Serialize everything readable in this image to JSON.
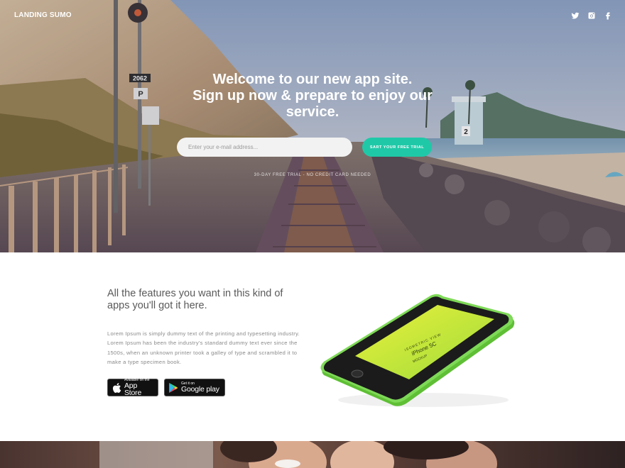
{
  "header": {
    "brand": "LANDING SUMO",
    "social_icons": [
      "twitter-icon",
      "instagram-icon",
      "facebook-icon"
    ]
  },
  "hero": {
    "headline_lines": [
      "Welcome to our new app site.",
      "Sign up now & prepare to enjoy our",
      "service."
    ],
    "email_placeholder": "Enter your e-mail address...",
    "cta_label": "SART YOUR FREE TRIAL",
    "note": "30-DAY FREE TRIAL - NO CREDIT CARD NEEDED"
  },
  "features": {
    "title_lines": [
      "All the features you want in this kind of",
      "apps you'll got it here."
    ],
    "body": "Lorem Ipsum is simply dummy text of the printing and typesetting industry. Lorem Ipsum has been the industry's standard dummy text ever since the 1500s, when an unknown printer took a galley of type and scrambled it to make a type specimen book.",
    "app_store": {
      "small": "Available on the",
      "big": "App Store"
    },
    "google_play": {
      "small": "Get it on",
      "big": "Google play"
    },
    "phone_screen": {
      "line1": "ISOMETRIC VIEW",
      "line2": "iPhone 5C",
      "line3": "MOCKUP"
    }
  },
  "colors": {
    "accent": "#1fc9a8",
    "phone_body": "#7ed957",
    "phone_screen": "#c8ea3c"
  }
}
